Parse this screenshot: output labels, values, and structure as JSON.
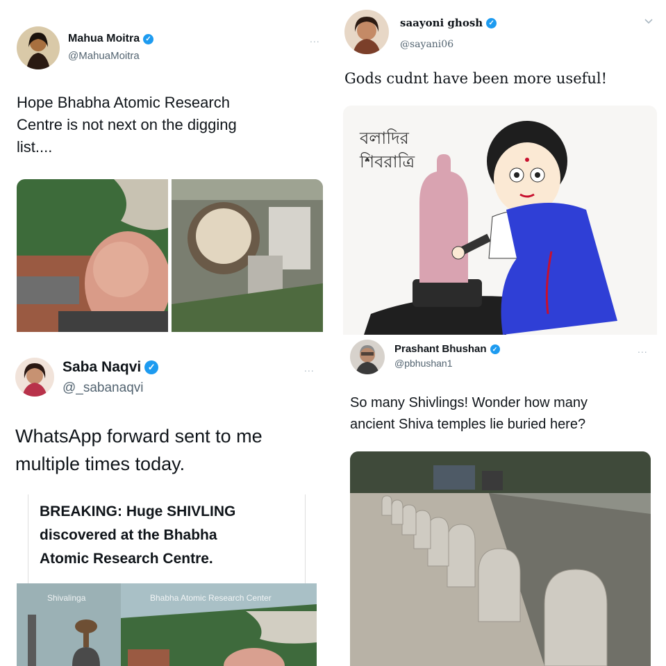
{
  "tweets": {
    "mahua": {
      "name": "Mahua Moitra",
      "handle": "@MahuaMoitra",
      "text": "Hope Bhabha Atomic Research\nCentre is not next on the digging\nlist....",
      "more": "..."
    },
    "saayoni": {
      "name": "saayoni ghosh",
      "handle": "@sayani06",
      "text": "Gods cudnt have been more useful!",
      "image_text": "বলাদির\nশিবরাত্রি"
    },
    "saba": {
      "name": "Saba Naqvi",
      "handle": "@_sabanaqvi",
      "text": "WhatsApp forward sent to me\nmultiple times today.",
      "more": "...",
      "card_text": "BREAKING: Huge SHIVLING\ndiscovered at the Bhabha\nAtomic Research Centre.",
      "image_label_left": "Shivalinga",
      "image_label_right": "Bhabha Atomic Research Center"
    },
    "prashant": {
      "name": "Prashant Bhushan",
      "handle": "@pbhushan1",
      "text": "So many Shivlings! Wonder how many\nancient Shiva temples lie buried here?",
      "more": "..."
    }
  },
  "icons": {
    "verified": "verified-badge-icon",
    "chevron": "chevron-down-icon",
    "more": "more-icon"
  },
  "colors": {
    "verified_blue": "#1d9bf0",
    "handle_gray": "#536471"
  }
}
